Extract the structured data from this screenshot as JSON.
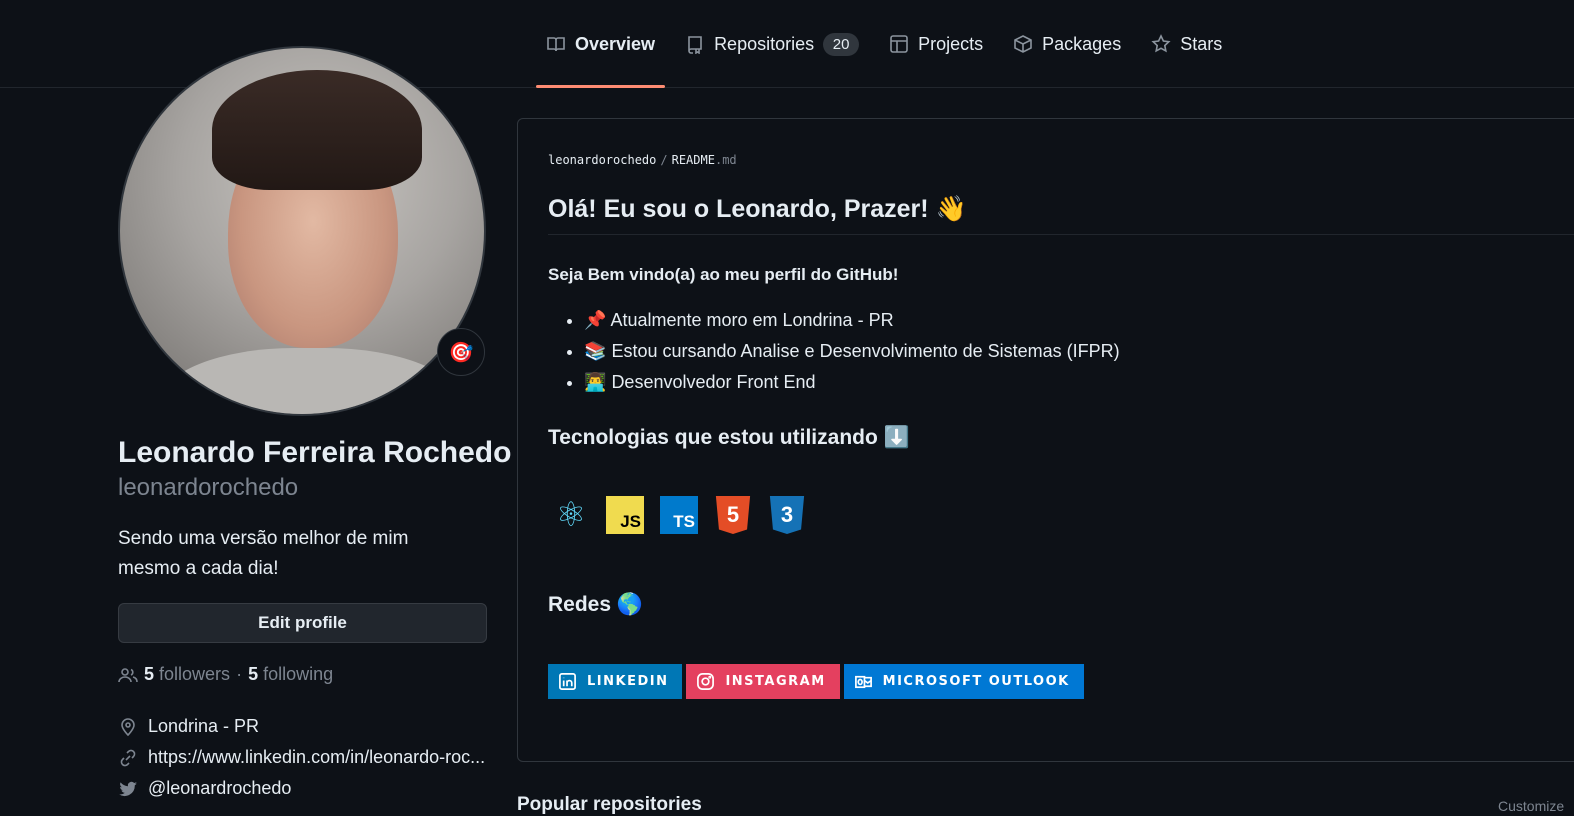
{
  "nav": {
    "tabs": [
      {
        "label": "Overview",
        "icon": "book-icon"
      },
      {
        "label": "Repositories",
        "icon": "repo-icon",
        "count": "20"
      },
      {
        "label": "Projects",
        "icon": "table-icon"
      },
      {
        "label": "Packages",
        "icon": "package-icon"
      },
      {
        "label": "Stars",
        "icon": "star-icon"
      }
    ],
    "active_color": "#fd8c73"
  },
  "profile": {
    "full_name": "Leonardo Ferreira Rochedo",
    "username": "leonardorochedo",
    "status_emoji": "🎯",
    "bio": "Sendo uma versão melhor de mim mesmo a cada dia!",
    "edit_label": "Edit profile",
    "followers_count": "5",
    "followers_label": "followers",
    "separator": "·",
    "following_count": "5",
    "following_label": "following",
    "location": "Londrina - PR",
    "website": "https://www.linkedin.com/in/leonardo-roc...",
    "twitter": "@leonardrochedo"
  },
  "readme": {
    "owner": "leonardorochedo",
    "sep": "/",
    "file": "README",
    "ext": ".md",
    "heading": "Olá! Eu sou o Leonardo, Prazer! 👋",
    "welcome": "Seja Bem vindo(a) ao meu perfil do GitHub!",
    "bullets": [
      {
        "emoji": "📌",
        "text": "Atualmente moro em Londrina - PR"
      },
      {
        "emoji": "📚",
        "text": "Estou cursando Analise e Desenvolvimento de Sistemas (IFPR)"
      },
      {
        "emoji": "👨‍💻",
        "text": "Desenvolvedor Front End"
      }
    ],
    "tech_heading": "Tecnologias que estou utilizando ⬇️",
    "tech": [
      {
        "name": "react-icon",
        "label": "⚛",
        "color": "#61dafb",
        "bg": "transparent"
      },
      {
        "name": "javascript-icon",
        "label": "JS",
        "color": "#000000",
        "bg": "#f0db4f"
      },
      {
        "name": "typescript-icon",
        "label": "TS",
        "color": "#ffffff",
        "bg": "#007acc"
      },
      {
        "name": "html5-icon",
        "label": "5",
        "color": "#ffffff",
        "bg": "#e44d26"
      },
      {
        "name": "css3-icon",
        "label": "3",
        "color": "#ffffff",
        "bg": "#1572b6"
      }
    ],
    "social_heading": "Redes 🌎",
    "badges": [
      {
        "label": "LINKEDIN",
        "color": "#0077b5",
        "icon": "linkedin-icon"
      },
      {
        "label": "INSTAGRAM",
        "color": "#e4405f",
        "icon": "instagram-icon"
      },
      {
        "label": "MICROSOFT OUTLOOK",
        "color": "#0078d4",
        "icon": "outlook-icon"
      }
    ]
  },
  "popular": {
    "heading": "Popular repositories",
    "customize": "Customize"
  }
}
